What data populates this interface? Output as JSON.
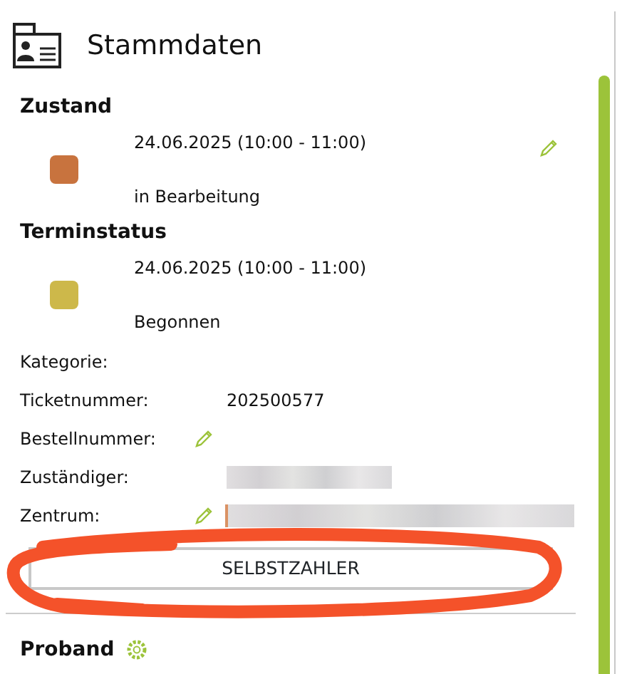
{
  "header": {
    "title": "Stammdaten"
  },
  "status_sections": [
    {
      "heading": "Zustand",
      "date": "24.06.2025 (10:00 - 11:00)",
      "status": "in Bearbeitung",
      "color": "#c8733e",
      "editable": true
    },
    {
      "heading": "Terminstatus",
      "date": "24.06.2025 (10:00 - 11:00)",
      "status": "Begonnen",
      "color": "#cdb84a",
      "editable": false
    }
  ],
  "fields": [
    {
      "label": "Kategorie:",
      "kind": "empty"
    },
    {
      "label": "Ticketnummer:",
      "kind": "text",
      "value": "202500577"
    },
    {
      "label": "Bestellnummer:",
      "kind": "edit"
    },
    {
      "label": "Zuständiger:",
      "kind": "redacted"
    },
    {
      "label": "Zentrum:",
      "kind": "edit_redacted"
    }
  ],
  "button": {
    "label": "SELBSTZAHLER"
  },
  "section": {
    "title": "Proband"
  }
}
